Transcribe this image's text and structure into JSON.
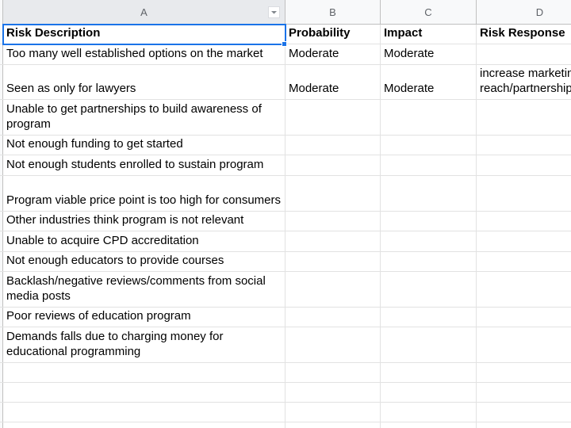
{
  "columns": [
    {
      "id": "A",
      "label": "A"
    },
    {
      "id": "B",
      "label": "B"
    },
    {
      "id": "C",
      "label": "C"
    },
    {
      "id": "D",
      "label": "D"
    }
  ],
  "filter_icon": "chevron-down-icon",
  "selected_cell": "A1",
  "rows": [
    {
      "cells": [
        "Risk Description",
        "Probability",
        "Impact",
        "Risk Response"
      ]
    },
    {
      "cells": [
        "Too many well established options on the market",
        "Moderate",
        "Moderate",
        ""
      ]
    },
    {
      "cells": [
        "Seen as only for lawyers",
        "Moderate",
        "Moderate",
        "increase marketing reach/partnerships"
      ]
    },
    {
      "cells": [
        "Unable to get partnerships to build awareness of program",
        "",
        "",
        ""
      ]
    },
    {
      "cells": [
        "Not enough funding to get started",
        "",
        "",
        ""
      ]
    },
    {
      "cells": [
        "Not enough students enrolled to sustain program",
        "",
        "",
        ""
      ]
    },
    {
      "cells": [
        "Program viable price point is too high for consumers",
        "",
        "",
        ""
      ]
    },
    {
      "cells": [
        "Other industries think program is not relevant",
        "",
        "",
        ""
      ]
    },
    {
      "cells": [
        "Unable to acquire CPD accreditation",
        "",
        "",
        ""
      ]
    },
    {
      "cells": [
        "Not enough educators to provide courses",
        "",
        "",
        ""
      ]
    },
    {
      "cells": [
        "Backlash/negative reviews/comments from social media posts",
        "",
        "",
        ""
      ]
    },
    {
      "cells": [
        "Poor reviews of education program",
        "",
        "",
        ""
      ]
    },
    {
      "cells": [
        "Demands falls due to charging money for educational programming",
        "",
        "",
        ""
      ]
    },
    {
      "cells": [
        "",
        "",
        "",
        ""
      ]
    },
    {
      "cells": [
        "",
        "",
        "",
        ""
      ]
    },
    {
      "cells": [
        "",
        "",
        "",
        ""
      ]
    },
    {
      "cells": [
        "",
        "",
        "",
        ""
      ]
    }
  ]
}
